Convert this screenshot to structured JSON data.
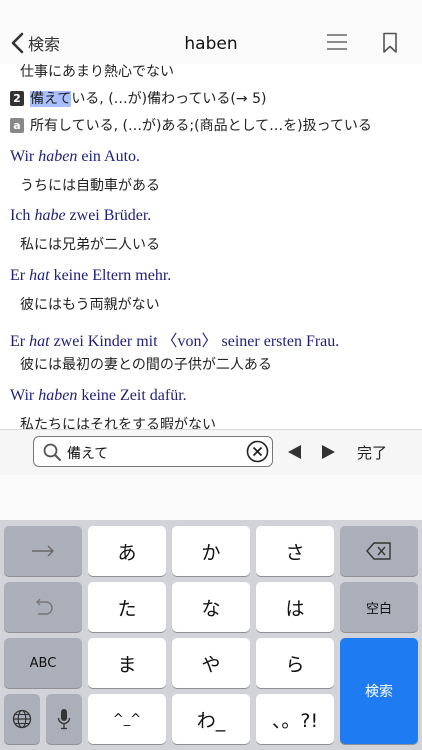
{
  "nav": {
    "back_label": "検索",
    "title": "haben"
  },
  "content": {
    "truncated_top": "仕事にあまり熱心でない",
    "def2": {
      "badge": "2",
      "highlight": "備えて",
      "text": "いる, (…が)備わっている(→ 5)"
    },
    "defa": {
      "badge": "a",
      "text": "所有している, (…が)ある;(商品として…を)扱っている"
    },
    "examples": [
      {
        "pre": "Wir ",
        "em": "haben",
        "post": " ein Auto.",
        "ja": "うちには自動車がある"
      },
      {
        "pre": "Ich ",
        "em": "habe",
        "post": " zwei Brüder.",
        "ja": "私には兄弟が二人いる"
      },
      {
        "pre": "Er ",
        "em": "hat",
        "post": " keine Eltern mehr.",
        "ja": "彼にはもう両親がない"
      },
      {
        "pre": "Er ",
        "em": "hat",
        "post": " zwei Kinder mit 〈von〉 seiner ersten Frau.",
        "ja": "彼には最初の妻との間の子供が二人ある"
      },
      {
        "pre": "Wir ",
        "em": "haben",
        "post": " keine Zeit dafür.",
        "ja": "私たちにはそれをする暇がない"
      }
    ]
  },
  "find": {
    "value": "備えて",
    "done_label": "完了"
  },
  "keyboard": {
    "row1": [
      "あ",
      "か",
      "さ"
    ],
    "row2": [
      "た",
      "な",
      "は"
    ],
    "row3": [
      "ま",
      "や",
      "ら"
    ],
    "row4": [
      "^_^",
      "わ_",
      "、。?!"
    ],
    "space_label": "空白",
    "abc_label": "ABC",
    "search_label": "検索"
  },
  "colors": {
    "accent": "#1e7bf2",
    "highlight": "#a9bfff",
    "example_text": "#1f1f7a"
  }
}
